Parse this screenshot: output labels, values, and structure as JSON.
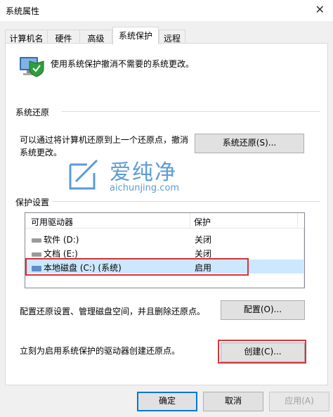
{
  "window": {
    "title": "系统属性"
  },
  "tabs": [
    "计算机名",
    "硬件",
    "高级",
    "系统保护",
    "远程"
  ],
  "intro_text": "使用系统保护撤消不需要的系统更改。",
  "restore": {
    "group_label": "系统还原",
    "description": "可以通过将计算机还原到上一个还原点，撤消系统更改。",
    "button": "系统还原(S)..."
  },
  "watermark": {
    "cn": "爱纯净",
    "en": "aichunjing.com"
  },
  "protection": {
    "group_label": "保护设置",
    "columns": [
      "可用驱动器",
      "保护"
    ],
    "drives": [
      {
        "name": "软件 (D:)",
        "status": "关闭"
      },
      {
        "name": "文档 (E:)",
        "status": "关闭"
      },
      {
        "name": "本地磁盘 (C:) (系统)",
        "status": "启用"
      }
    ],
    "config_desc": "配置还原设置、管理磁盘空间，并且删除还原点。",
    "config_button": "配置(O)...",
    "create_desc": "立刻为启用系统保护的驱动器创建还原点。",
    "create_button": "创建(C)..."
  },
  "footer": {
    "ok": "确定",
    "cancel": "取消",
    "apply": "应用(A)"
  },
  "colors": {
    "selection": "#cce8ff",
    "highlight_box": "#d9323a",
    "primary_border": "#0078d7"
  }
}
